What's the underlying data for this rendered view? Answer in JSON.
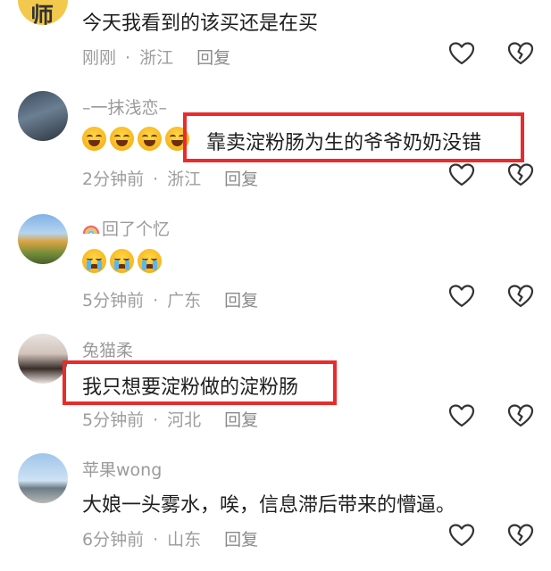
{
  "comments": [
    {
      "user": "",
      "avatar_text": "师",
      "text": "今天我看到的该买还是在买",
      "time": "刚刚",
      "location": "浙江",
      "reply": "回复"
    },
    {
      "user": "–一抹浅恋–",
      "emojis": [
        "laugh-cry",
        "laugh-cry",
        "laugh-cry",
        "laugh-cry"
      ],
      "text": "靠卖淀粉肠为生的爷爷奶奶没错",
      "time": "2分钟前",
      "location": "浙江",
      "reply": "回复"
    },
    {
      "user": "回了个忆",
      "user_icon": "rainbow-icon",
      "emojis": [
        "crying",
        "crying",
        "crying"
      ],
      "text": "",
      "time": "5分钟前",
      "location": "广东",
      "reply": "回复"
    },
    {
      "user": "兔猫柔",
      "text": "我只想要淀粉做的淀粉肠",
      "time": "5分钟前",
      "location": "河北",
      "reply": "回复"
    },
    {
      "user": "苹果wong",
      "text": "大娘一头雾水，唉，信息滞后带来的懵逼。",
      "time": "6分钟前",
      "location": "山东",
      "reply": "回复"
    }
  ],
  "meta_separator": "·",
  "colors": {
    "highlight": "#ea2b2b",
    "text": "#1e1e1e",
    "meta": "#9d9d9d"
  },
  "icons": {
    "like": "heart-outline-icon",
    "dislike": "broken-heart-icon"
  }
}
